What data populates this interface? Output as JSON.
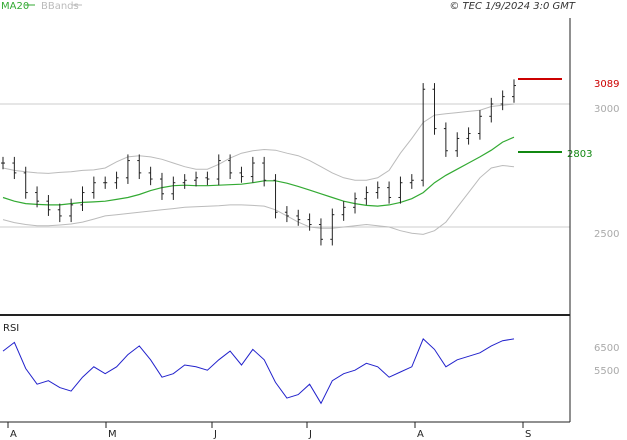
{
  "header": {
    "ma_label": "MA20",
    "bb_label": "BBands",
    "copyright": "© TEC 1/9/2024 3:0 GMT"
  },
  "colors": {
    "price_bars": "#222222",
    "ma20": "#33aa33",
    "bbands": "#bbbbbb",
    "rsi": "#2222cc",
    "resistance": "#cc0000",
    "support": "#118811",
    "gridline": "#cccccc",
    "frame": "#222222"
  },
  "chart_data": [
    {
      "type": "line",
      "panel": "price",
      "x_labels": [
        "A",
        "M",
        "J",
        "J",
        "A",
        "S"
      ],
      "y_ticks": [
        "3000",
        "2500"
      ],
      "y_tick_values": [
        3000,
        2500
      ],
      "ylim": [
        2000,
        3330
      ],
      "series": [
        {
          "name": "MA20",
          "values": [
            2620,
            2605,
            2595,
            2592,
            2590,
            2590,
            2595,
            2600,
            2602,
            2605,
            2612,
            2620,
            2632,
            2648,
            2660,
            2668,
            2670,
            2668,
            2668,
            2670,
            2672,
            2674,
            2680,
            2688,
            2688,
            2678,
            2665,
            2650,
            2635,
            2620,
            2605,
            2595,
            2588,
            2585,
            2590,
            2600,
            2615,
            2640,
            2680,
            2710,
            2735,
            2760,
            2785,
            2812,
            2845,
            2865
          ]
        },
        {
          "name": "BBands",
          "values": [
            2740,
            2730,
            2725,
            2720,
            2718,
            2722,
            2725,
            2730,
            2732,
            2740,
            2765,
            2785,
            2790,
            2785,
            2775,
            2760,
            2745,
            2735,
            2735,
            2755,
            2780,
            2800,
            2810,
            2815,
            2812,
            2800,
            2790,
            2770,
            2745,
            2720,
            2700,
            2690,
            2690,
            2700,
            2730,
            2800,
            2860,
            2925,
            2955,
            2960,
            2965,
            2970,
            2975,
            2990,
            2995,
            3000
          ]
        },
        {
          "values": [
            2530,
            2518,
            2510,
            2505,
            2505,
            2508,
            2512,
            2520,
            2532,
            2545,
            2550,
            2555,
            2560,
            2565,
            2570,
            2575,
            2580,
            2582,
            2584,
            2586,
            2590,
            2590,
            2588,
            2585,
            2570,
            2545,
            2520,
            2500,
            2495,
            2495,
            2500,
            2505,
            2510,
            2505,
            2500,
            2485,
            2475,
            2470,
            2485,
            2520,
            2580,
            2640,
            2700,
            2740,
            2750,
            2745
          ]
        },
        {
          "name": "Price",
          "values": [
            2760,
            2720,
            2640,
            2605,
            2570,
            2545,
            2590,
            2640,
            2680,
            2680,
            2700,
            2770,
            2720,
            2695,
            2635,
            2680,
            2690,
            2700,
            2695,
            2770,
            2720,
            2705,
            2760,
            2690,
            2560,
            2545,
            2530,
            2510,
            2450,
            2550,
            2580,
            2615,
            2640,
            2660,
            2620,
            2680,
            2690,
            3060,
            2900,
            2810,
            2860,
            2880,
            2950,
            3000,
            3030,
            3075
          ]
        }
      ],
      "annotations": {
        "resistance": 3089,
        "support": 2803
      }
    },
    {
      "type": "line",
      "panel": "rsi",
      "series": [
        {
          "name": "RSI",
          "values": [
            65,
            70,
            55,
            46,
            48,
            44,
            42,
            50,
            56,
            52,
            56,
            63,
            68,
            60,
            50,
            52,
            57,
            56,
            54,
            60,
            65,
            57,
            66,
            60,
            47,
            38,
            40,
            46,
            35,
            48,
            52,
            54,
            58,
            56,
            50,
            53,
            56,
            72,
            66,
            56,
            60,
            62,
            64,
            68,
            71,
            72
          ]
        }
      ],
      "title": "RSI",
      "y_ticks": [
        "6500",
        "5500"
      ],
      "ylim": [
        30,
        80
      ]
    }
  ]
}
